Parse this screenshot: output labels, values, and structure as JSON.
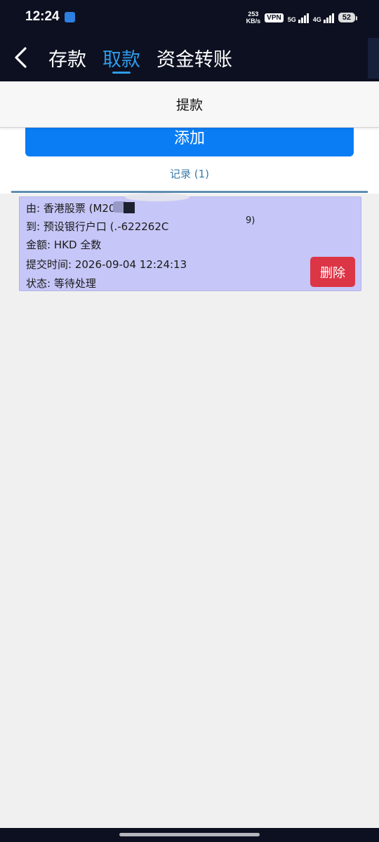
{
  "status_bar": {
    "time": "12:24",
    "net_speed_value": "253",
    "net_speed_unit": "KB/s",
    "vpn": "VPN",
    "sig1": "5G",
    "sig2": "4G",
    "battery": "52"
  },
  "nav": {
    "tabs": [
      "存款",
      "取款",
      "资金转账"
    ],
    "active_tab": "取款",
    "accent_color": "#2f9ae9"
  },
  "page": {
    "title": "提款",
    "add_label": "添加",
    "records_label": "记录 (1)"
  },
  "record": {
    "from": "由: 香港股票 (M20",
    "to": "到: 预设银行户口 (.-622262C",
    "to_fragment": "9)",
    "amount": "金额: HKD 全数",
    "submitted": "提交时间: 2026-09-04 12:24:13",
    "status": "状态: 等待处理",
    "delete_label": "删除",
    "card_color": "#c6c6f8",
    "delete_color": "#dc3545"
  },
  "colors": {
    "primary": "#0a7df5",
    "header_bg": "#0c1020"
  }
}
